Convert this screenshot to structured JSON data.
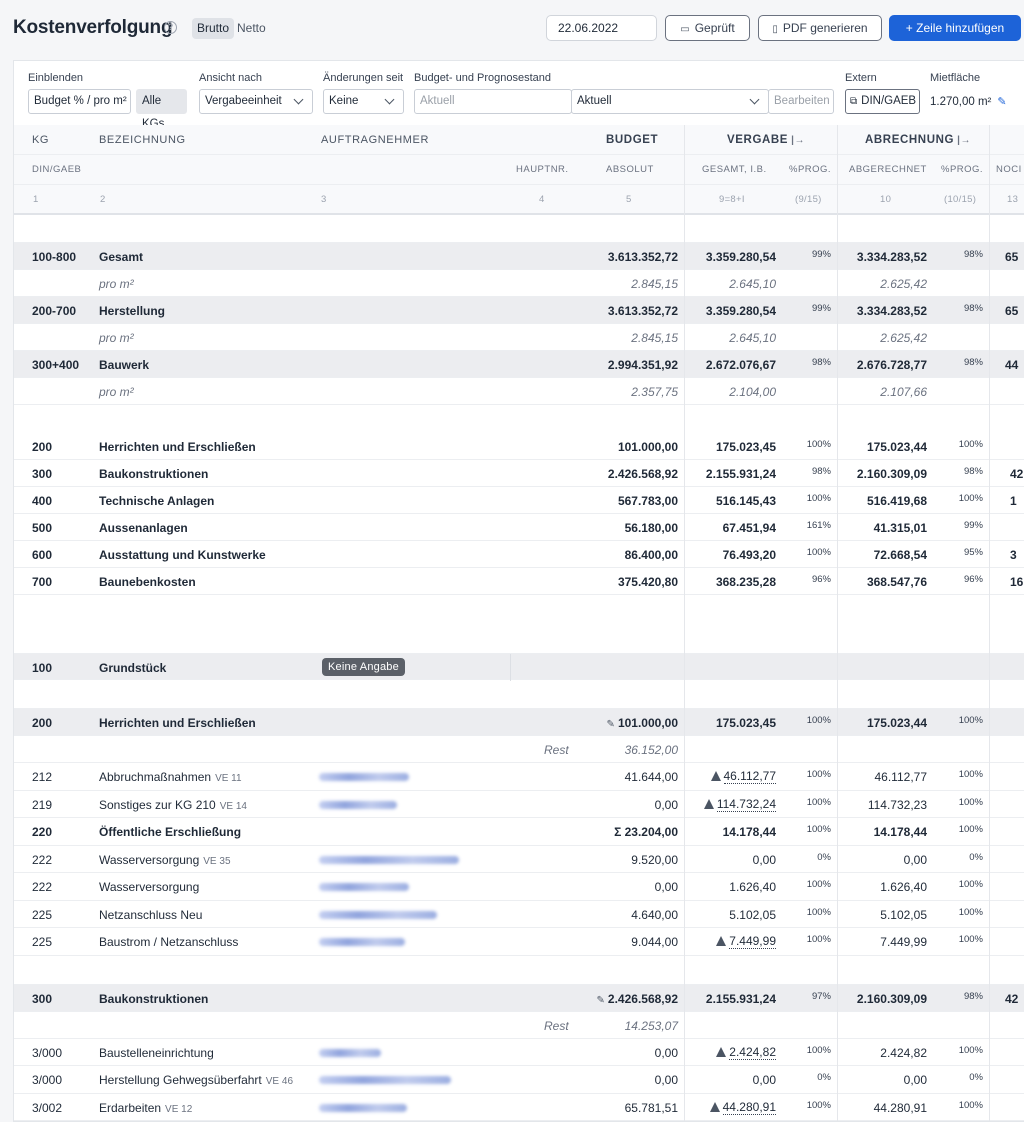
{
  "header": {
    "title": "Kostenverfolgung",
    "help_icon": "?",
    "toggle_brutto": "Brutto",
    "toggle_netto": "Netto",
    "date": "22.06.2022",
    "geprueft_label": "Geprüft",
    "pdf_label": "PDF generieren",
    "add_row_label": "+ Zeile hinzufügen",
    "calendar_icon": "calendar-icon",
    "pdf_icon": "document-icon",
    "accent_color": "#1d63d8"
  },
  "filters": {
    "einblenden_label": "Einblenden",
    "einblenden_value": "Budget % / pro m²",
    "alle_kgs": "Alle KGs",
    "ansicht_label": "Ansicht nach",
    "ansicht_value": "Vergabeeinheit",
    "aenderungen_label": "Änderungen seit",
    "aenderungen_value": "Keine",
    "budget_label": "Budget- und Prognosestand",
    "budget_placeholder": "Aktuell",
    "prognose_value": "Aktuell",
    "bearbeiten_label": "Bearbeiten",
    "extern_label": "Extern",
    "extern_button": "DIN/GAEB",
    "mietflaeche_label": "Mietfläche",
    "mietflaeche_value": "1.270,00 m²"
  },
  "columns": {
    "kg": "KG",
    "bezeichnung": "BEZEICHNUNG",
    "auftragnehmer": "AUFTRAGNEHMER",
    "budget": "BUDGET",
    "vergabe": "VERGABE",
    "abrechnung": "ABRECHNUNG",
    "din_gaeb": "DIN/GAEB",
    "hauptnr": "HAUPTNR.",
    "absolut": "ABSOLUT",
    "gesamt_ib": "GESAMT, I.B.",
    "prog1": "%PROG.",
    "abgerechnet": "ABGERECHNET",
    "prog2": "%PROG.",
    "noch": "NOCI",
    "n1": "1",
    "n2": "2",
    "n3": "3",
    "n4": "4",
    "n5": "5",
    "n6": "9=8+I",
    "n7": "(9/15)",
    "n8": "10",
    "n9": "(10/15)",
    "n10": "13"
  },
  "summary": [
    {
      "kg": "100-800",
      "name": "Gesamt",
      "budget": "3.613.352,72",
      "vergabe": "3.359.280,54",
      "vpct": "99%",
      "abr": "3.334.283,52",
      "apct": "98%",
      "noch": "65"
    },
    {
      "kg": "",
      "name": "pro m²",
      "budget": "2.845,15",
      "vergabe": "2.645,10",
      "vpct": "",
      "abr": "2.625,42",
      "apct": "",
      "noch": ""
    },
    {
      "kg": "200-700",
      "name": "Herstellung",
      "budget": "3.613.352,72",
      "vergabe": "3.359.280,54",
      "vpct": "99%",
      "abr": "3.334.283,52",
      "apct": "98%",
      "noch": "65"
    },
    {
      "kg": "",
      "name": "pro m²",
      "budget": "2.845,15",
      "vergabe": "2.645,10",
      "vpct": "",
      "abr": "2.625,42",
      "apct": "",
      "noch": ""
    },
    {
      "kg": "300+400",
      "name": "Bauwerk",
      "budget": "2.994.351,92",
      "vergabe": "2.672.076,67",
      "vpct": "98%",
      "abr": "2.676.728,77",
      "apct": "98%",
      "noch": "44"
    },
    {
      "kg": "",
      "name": "pro m²",
      "budget": "2.357,75",
      "vergabe": "2.104,00",
      "vpct": "",
      "abr": "2.107,66",
      "apct": "",
      "noch": ""
    }
  ],
  "groups": [
    {
      "kg": "200",
      "name": "Herrichten und Erschließen",
      "budget": "101.000,00",
      "vergabe": "175.023,45",
      "vpct": "100%",
      "abr": "175.023,44",
      "apct": "100%",
      "noch": ""
    },
    {
      "kg": "300",
      "name": "Baukonstruktionen",
      "budget": "2.426.568,92",
      "vergabe": "2.155.931,24",
      "vpct": "98%",
      "abr": "2.160.309,09",
      "apct": "98%",
      "noch": "42"
    },
    {
      "kg": "400",
      "name": "Technische Anlagen",
      "budget": "567.783,00",
      "vergabe": "516.145,43",
      "vpct": "100%",
      "abr": "516.419,68",
      "apct": "100%",
      "noch": "1"
    },
    {
      "kg": "500",
      "name": "Aussenanlagen",
      "budget": "56.180,00",
      "vergabe": "67.451,94",
      "vpct": "161%",
      "abr": "41.315,01",
      "apct": "99%",
      "noch": ""
    },
    {
      "kg": "600",
      "name": "Ausstattung und Kunstwerke",
      "budget": "86.400,00",
      "vergabe": "76.493,20",
      "vpct": "100%",
      "abr": "72.668,54",
      "apct": "95%",
      "noch": "3"
    },
    {
      "kg": "700",
      "name": "Baunebenkosten",
      "budget": "375.420,80",
      "vergabe": "368.235,28",
      "vpct": "96%",
      "abr": "368.547,76",
      "apct": "96%",
      "noch": "16"
    }
  ],
  "kg100": {
    "kg": "100",
    "name": "Grundstück",
    "badge": "Keine Angabe"
  },
  "kg200": {
    "head": {
      "kg": "200",
      "name": "Herrichten und Erschließen",
      "budget": "101.000,00",
      "vergabe": "175.023,45",
      "vpct": "100%",
      "abr": "175.023,44",
      "apct": "100%"
    },
    "rest_label": "Rest",
    "rest_value": "36.152,00",
    "items": [
      {
        "kg": "212",
        "name": "Abbruchmaßnahmen",
        "ve": "VE 11",
        "budget": "41.644,00",
        "vergabe": "46.112,77",
        "warn": true,
        "vpct": "100%",
        "abr": "46.112,77",
        "apct": "100%",
        "bold": false
      },
      {
        "kg": "219",
        "name": "Sonstiges zur KG 210",
        "ve": "VE 14",
        "budget": "0,00",
        "vergabe": "114.732,24",
        "warn": true,
        "vpct": "100%",
        "abr": "114.732,23",
        "apct": "100%",
        "bold": false
      },
      {
        "kg": "220",
        "name": "Öffentliche Erschließung",
        "ve": "",
        "budget": "Σ 23.204,00",
        "vergabe": "14.178,44",
        "warn": false,
        "vpct": "100%",
        "abr": "14.178,44",
        "apct": "100%",
        "bold": true
      },
      {
        "kg": "222",
        "name": "Wasserversorgung",
        "ve": "VE 35",
        "budget": "9.520,00",
        "vergabe": "0,00",
        "warn": false,
        "vpct": "0%",
        "abr": "0,00",
        "apct": "0%",
        "bold": false
      },
      {
        "kg": "222",
        "name": "Wasserversorgung",
        "ve": "",
        "budget": "0,00",
        "vergabe": "1.626,40",
        "warn": false,
        "vpct": "100%",
        "abr": "1.626,40",
        "apct": "100%",
        "bold": false
      },
      {
        "kg": "225",
        "name": "Netzanschluss Neu",
        "ve": "",
        "budget": "4.640,00",
        "vergabe": "5.102,05",
        "warn": false,
        "vpct": "100%",
        "abr": "5.102,05",
        "apct": "100%",
        "bold": false
      },
      {
        "kg": "225",
        "name": "Baustrom / Netzanschluss",
        "ve": "",
        "budget": "9.044,00",
        "vergabe": "7.449,99",
        "warn": true,
        "vpct": "100%",
        "abr": "7.449,99",
        "apct": "100%",
        "bold": false
      }
    ]
  },
  "kg300": {
    "head": {
      "kg": "300",
      "name": "Baukonstruktionen",
      "budget": "2.426.568,92",
      "vergabe": "2.155.931,24",
      "vpct": "97%",
      "abr": "2.160.309,09",
      "apct": "98%",
      "noch": "42"
    },
    "rest_label": "Rest",
    "rest_value": "14.253,07",
    "items": [
      {
        "kg": "3/000",
        "name": "Baustelleneinrichtung",
        "ve": "",
        "budget": "0,00",
        "vergabe": "2.424,82",
        "warn": true,
        "vpct": "100%",
        "abr": "2.424,82",
        "apct": "100%",
        "bold": false
      },
      {
        "kg": "3/000",
        "name": "Herstellung Gehwegsüberfahrt",
        "ve": "VE 46",
        "budget": "0,00",
        "vergabe": "0,00",
        "warn": false,
        "vpct": "0%",
        "abr": "0,00",
        "apct": "0%",
        "bold": false
      },
      {
        "kg": "3/002",
        "name": "Erdarbeiten",
        "ve": "VE 12",
        "budget": "65.781,51",
        "vergabe": "44.280,91",
        "warn": true,
        "vpct": "100%",
        "abr": "44.280,91",
        "apct": "100%",
        "bold": false
      }
    ]
  }
}
